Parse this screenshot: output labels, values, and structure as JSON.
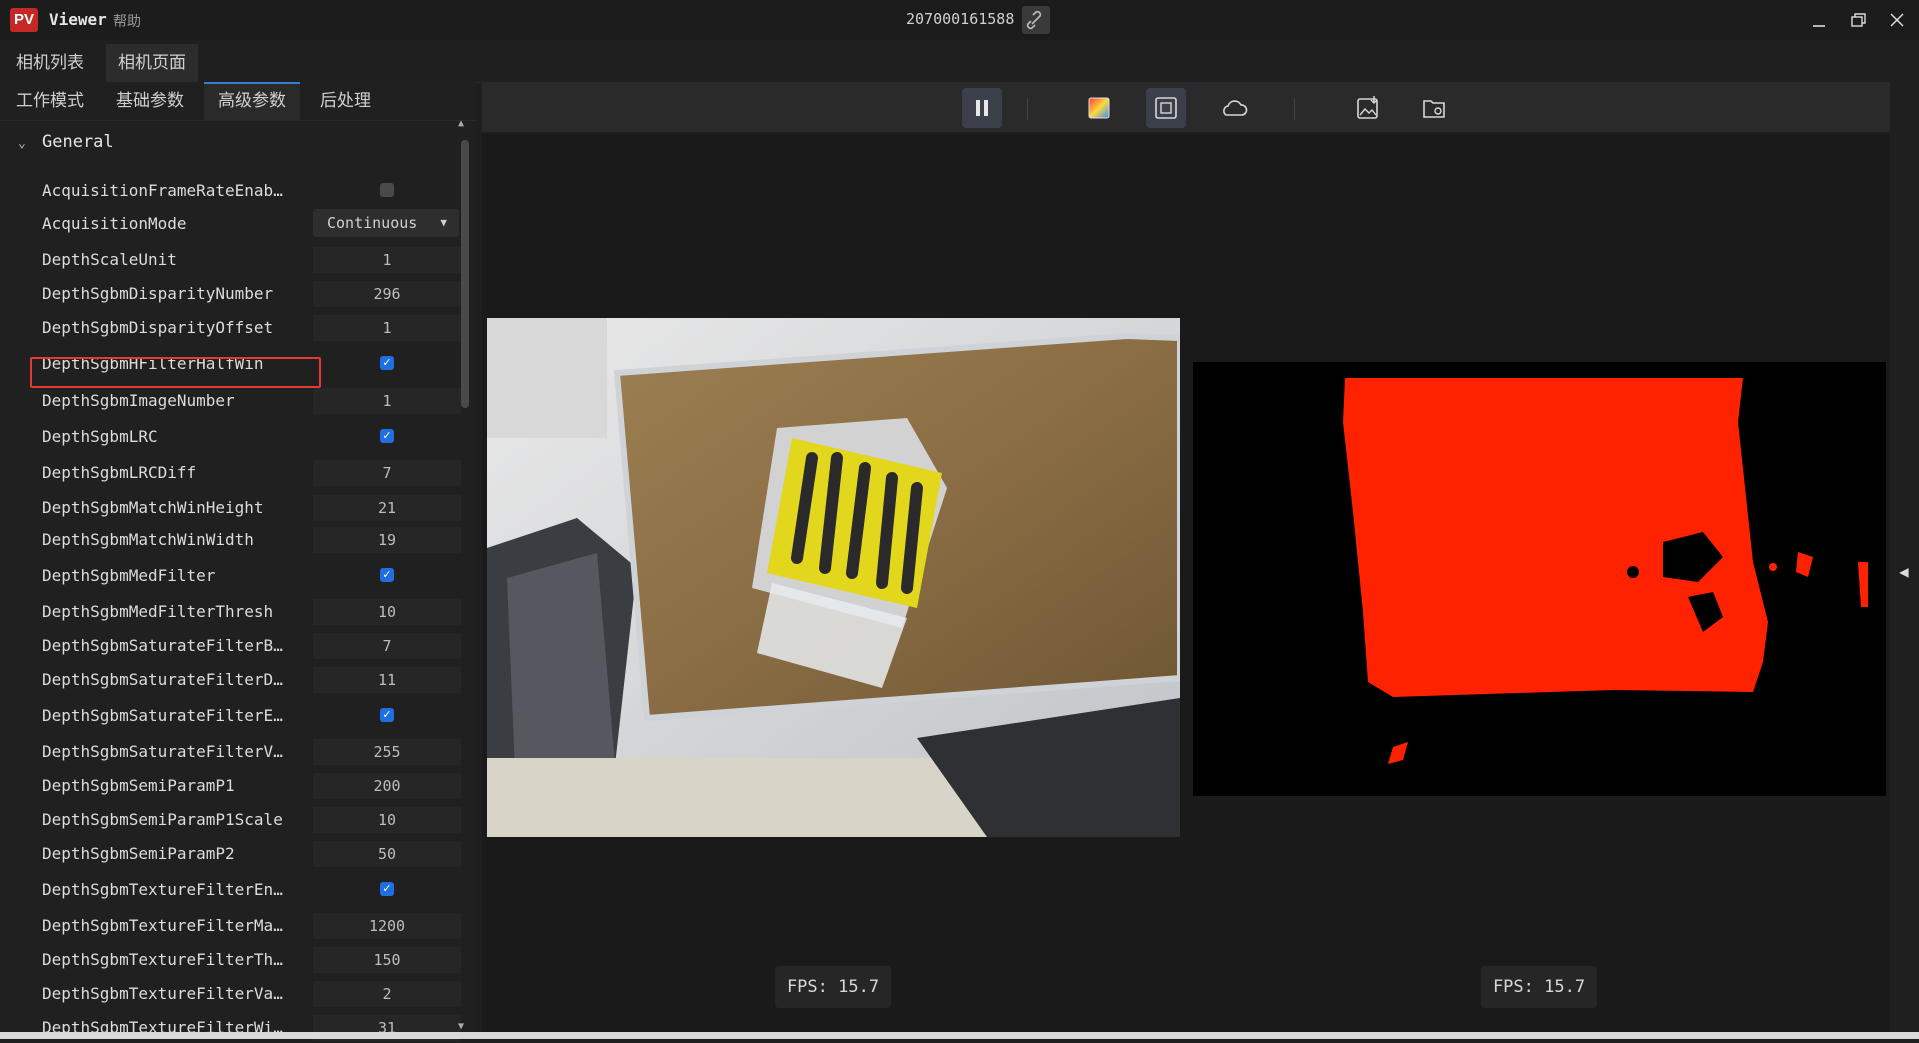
{
  "titlebar": {
    "logo_text": "PV",
    "app_title": "Viewer",
    "menu_help": "帮助",
    "serial": "207000161588",
    "icons": [
      "link-broken-icon",
      "minimize-icon",
      "restore-icon",
      "close-icon"
    ]
  },
  "top_tabs": [
    {
      "label": "相机列表",
      "active": false
    },
    {
      "label": "相机页面",
      "active": true
    }
  ],
  "sub_tabs": [
    {
      "label": "工作模式",
      "active": false
    },
    {
      "label": "基础参数",
      "active": false
    },
    {
      "label": "高级参数",
      "active": true
    },
    {
      "label": "后处理",
      "active": false
    }
  ],
  "group": {
    "label": "General",
    "expanded": true
  },
  "params": [
    {
      "name": "AcquisitionFrameRateEnab…",
      "type": "check",
      "checked": false
    },
    {
      "name": "AcquisitionMode",
      "type": "select",
      "value": "Continuous"
    },
    {
      "name": "DepthScaleUnit",
      "type": "value",
      "value": "1"
    },
    {
      "name": "DepthSgbmDisparityNumber",
      "type": "value",
      "value": "296",
      "highlighted": true
    },
    {
      "name": "DepthSgbmDisparityOffset",
      "type": "value",
      "value": "1"
    },
    {
      "name": "DepthSgbmHFilterHalfWin",
      "type": "check",
      "checked": true
    },
    {
      "name": "DepthSgbmImageNumber",
      "type": "value",
      "value": "1"
    },
    {
      "name": "DepthSgbmLRC",
      "type": "check",
      "checked": true
    },
    {
      "name": "DepthSgbmLRCDiff",
      "type": "value",
      "value": "7"
    },
    {
      "name": "DepthSgbmMatchWinHeight",
      "type": "value",
      "value": "21"
    },
    {
      "name": "DepthSgbmMatchWinWidth",
      "type": "value",
      "value": "19"
    },
    {
      "name": "DepthSgbmMedFilter",
      "type": "check",
      "checked": true
    },
    {
      "name": "DepthSgbmMedFilterThresh",
      "type": "value",
      "value": "10"
    },
    {
      "name": "DepthSgbmSaturateFilterB…",
      "type": "value",
      "value": "7"
    },
    {
      "name": "DepthSgbmSaturateFilterD…",
      "type": "value",
      "value": "11"
    },
    {
      "name": "DepthSgbmSaturateFilterE…",
      "type": "check",
      "checked": true
    },
    {
      "name": "DepthSgbmSaturateFilterV…",
      "type": "value",
      "value": "255"
    },
    {
      "name": "DepthSgbmSemiParamP1",
      "type": "value",
      "value": "200"
    },
    {
      "name": "DepthSgbmSemiParamP1Scale",
      "type": "value",
      "value": "10"
    },
    {
      "name": "DepthSgbmSemiParamP2",
      "type": "value",
      "value": "50"
    },
    {
      "name": "DepthSgbmTextureFilterEn…",
      "type": "check",
      "checked": true
    },
    {
      "name": "DepthSgbmTextureFilterMa…",
      "type": "value",
      "value": "1200"
    },
    {
      "name": "DepthSgbmTextureFilterTh…",
      "type": "value",
      "value": "150"
    },
    {
      "name": "DepthSgbmTextureFilterVa…",
      "type": "value",
      "value": "2"
    },
    {
      "name": "DepthSgbmTextureFilterWi…",
      "type": "value",
      "value": "31"
    }
  ],
  "toolbar": {
    "buttons": [
      {
        "icon": "pause-icon",
        "active": true
      },
      {
        "icon": "color-image-icon",
        "active": false
      },
      {
        "icon": "depth-frame-icon",
        "active": true
      },
      {
        "icon": "point-cloud-icon",
        "active": false
      },
      {
        "icon": "save-image-icon",
        "active": false
      },
      {
        "icon": "open-folder-icon",
        "active": false
      }
    ]
  },
  "views": {
    "color": {
      "fps_label": "FPS: 15.7"
    },
    "depth": {
      "fps_label": "FPS: 15.7",
      "color": "#ff2200"
    }
  },
  "colors": {
    "accent": "#1f6fe0",
    "highlight": "#e53935",
    "depth_red": "#ff2200",
    "logo": "#c62828"
  }
}
